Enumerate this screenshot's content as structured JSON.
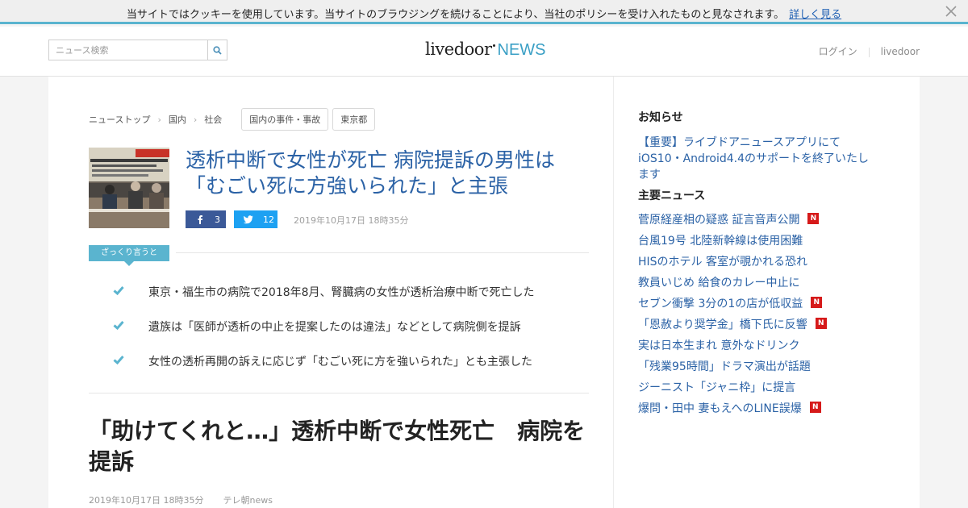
{
  "cookie_bar": {
    "text": "当サイトではクッキーを使用しています。当サイトのブラウジングを続けることにより、当社のポリシーを受け入れたものと見なされます。",
    "link": "詳しく見る",
    "close_icon": "close-icon"
  },
  "header": {
    "search_placeholder": "ニュース検索",
    "search_icon": "search-icon",
    "logo_main": "livedoor",
    "logo_sub": "NEWS",
    "links": [
      "ログイン",
      "livedoor"
    ]
  },
  "breadcrumb": {
    "items": [
      "ニューストップ",
      "国内",
      "社会"
    ],
    "tags": [
      "国内の事件・事故",
      "東京都"
    ]
  },
  "article": {
    "headline": "透析中断で女性が死亡 病院提訴の男性は「むごい死に方強いられた」と主張",
    "share": {
      "facebook_count": "3",
      "twitter_count": "12"
    },
    "date": "2019年10月17日 18時35分",
    "summary_label": "ざっくり言うと",
    "summary": [
      "東京・福生市の病院で2018年8月、腎臓病の女性が透析治療中断で死亡した",
      "遺族は「医師が透析の中止を提案したのは違法」などとして病院側を提訴",
      "女性の透析再開の訴えに応じず「むごい死に方を強いられた」とも主張した"
    ],
    "title": "「助けてくれと…」透析中断で女性死亡　病院を提訴",
    "meta_date": "2019年10月17日 18時35分",
    "meta_source": "テレ朝news"
  },
  "sidebar": {
    "notice_heading": "お知らせ",
    "notice_text": "【重要】ライブドアニュースアプリにてiOS10・Android4.4のサポートを終了いたします",
    "news_heading": "主要ニュース",
    "new_badge": "N",
    "news": [
      {
        "title": "菅原経産相の疑惑 証言音声公開",
        "is_new": true
      },
      {
        "title": "台風19号 北陸新幹線は使用困難",
        "is_new": false
      },
      {
        "title": "HISのホテル 客室が覗かれる恐れ",
        "is_new": false
      },
      {
        "title": "教員いじめ 給食のカレー中止に",
        "is_new": false
      },
      {
        "title": "セブン衝撃 3分の1の店が低収益",
        "is_new": true
      },
      {
        "title": "「恩赦より奨学金」橋下氏に反響",
        "is_new": true
      },
      {
        "title": "実は日本生まれ 意外なドリンク",
        "is_new": false
      },
      {
        "title": "「残業95時間」ドラマ演出が話題",
        "is_new": false
      },
      {
        "title": "ジーニスト「ジャニ枠」に提言",
        "is_new": false
      },
      {
        "title": "爆問・田中 妻もえへのLINE誤爆",
        "is_new": true
      }
    ]
  },
  "colors": {
    "accent": "#5ab4cf",
    "link": "#2b62a6",
    "facebook": "#3b5998",
    "twitter": "#1da1f2",
    "new_badge": "#d61a1a"
  }
}
